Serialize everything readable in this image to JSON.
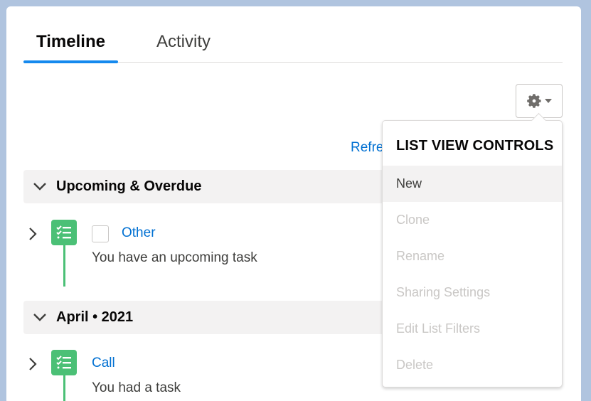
{
  "tabs": [
    {
      "label": "Timeline",
      "active": true
    },
    {
      "label": "Activity",
      "active": false
    }
  ],
  "toolbar": {
    "refresh_label": "Refre",
    "settings_icon": "gear-icon"
  },
  "sections": [
    {
      "title": "Upcoming & Overdue",
      "items": [
        {
          "type_icon": "task-icon",
          "has_checkbox": true,
          "link": "Other",
          "description": "You have an upcoming task"
        }
      ]
    },
    {
      "title": "April • 2021",
      "items": [
        {
          "type_icon": "task-icon",
          "has_checkbox": false,
          "link": "Call",
          "description": "You had a task"
        }
      ]
    }
  ],
  "menu": {
    "header": "LIST VIEW CONTROLS",
    "items": [
      {
        "label": "New",
        "enabled": true
      },
      {
        "label": "Clone",
        "enabled": false
      },
      {
        "label": "Rename",
        "enabled": false
      },
      {
        "label": "Sharing Settings",
        "enabled": false
      },
      {
        "label": "Edit List Filters",
        "enabled": false
      },
      {
        "label": "Delete",
        "enabled": false
      }
    ]
  },
  "colors": {
    "accent": "#1589ee",
    "link": "#0070d2",
    "task": "#4bc076",
    "disabled": "#c9c7c5"
  }
}
